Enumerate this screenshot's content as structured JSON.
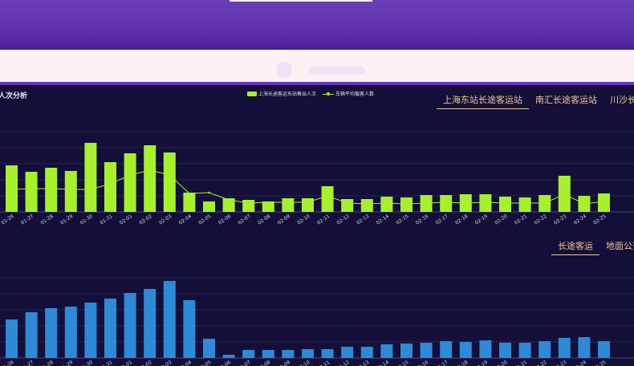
{
  "page": {
    "top_chart_title": "人次分析",
    "top_tabs": [
      "上海东站长途客运站",
      "南汇长途客运站",
      "川沙长途客"
    ],
    "bottom_tabs": [
      "长途客运",
      "地面公交"
    ]
  },
  "colors": {
    "bar_top": "#a6f12b",
    "bar_bottom": "#2d8ad6",
    "line": "#a6f12b",
    "grid": "#2a2656",
    "background": "#130f38"
  },
  "chart_data": [
    {
      "type": "bar",
      "categories": [
        "01-26",
        "01-27",
        "01-28",
        "01-29",
        "01-30",
        "01-31",
        "02-01",
        "02-02",
        "02-03",
        "02-04",
        "02-05",
        "02-06",
        "02-07",
        "02-08",
        "02-09",
        "02-10",
        "02-11",
        "02-12",
        "02-13",
        "02-14",
        "02-15",
        "02-16",
        "02-17",
        "02-18",
        "02-19",
        "02-20",
        "02-21",
        "02-22",
        "02-23",
        "02-24",
        "02-25"
      ],
      "series": [
        {
          "name": "上海长途客运东站售出人次",
          "kind": "bar",
          "values": [
            58,
            50,
            55,
            51,
            86,
            62,
            73,
            83,
            74,
            24,
            13,
            17,
            15,
            13,
            17,
            17,
            32,
            16,
            16,
            19,
            18,
            21,
            21,
            22,
            22,
            19,
            18,
            21,
            45,
            20,
            23
          ]
        },
        {
          "name": "车辆平均载客人数",
          "kind": "line",
          "values": [
            28,
            29,
            29,
            28,
            28,
            35,
            46,
            52,
            46,
            23,
            24,
            15,
            11,
            12,
            12,
            12,
            20,
            11,
            10,
            11,
            10,
            11,
            12,
            11,
            12,
            11,
            11,
            11,
            22,
            10,
            13
          ]
        }
      ],
      "ylim": [
        0,
        100
      ],
      "grid": true,
      "legend": "top-center"
    },
    {
      "type": "bar",
      "categories": [
        "01-26",
        "01-27",
        "01-28",
        "01-29",
        "01-30",
        "01-31",
        "02-01",
        "02-02",
        "02-03",
        "02-04",
        "02-05",
        "02-06",
        "02-07",
        "02-08",
        "02-09",
        "02-10",
        "02-11",
        "02-12",
        "02-13",
        "02-14",
        "02-15",
        "02-16",
        "02-17",
        "02-18",
        "02-19",
        "02-20",
        "02-21",
        "02-22",
        "02-23",
        "02-24",
        "02-25"
      ],
      "series": [
        {
          "kind": "bar",
          "values": [
            48,
            57,
            62,
            64,
            69,
            74,
            81,
            86,
            96,
            72,
            24,
            4,
            10,
            10,
            10,
            11,
            11,
            14,
            14,
            17,
            18,
            19,
            21,
            20,
            22,
            19,
            19,
            21,
            25,
            26,
            21
          ]
        }
      ],
      "ylim": [
        0,
        100
      ],
      "grid": true,
      "legend": "none"
    }
  ]
}
